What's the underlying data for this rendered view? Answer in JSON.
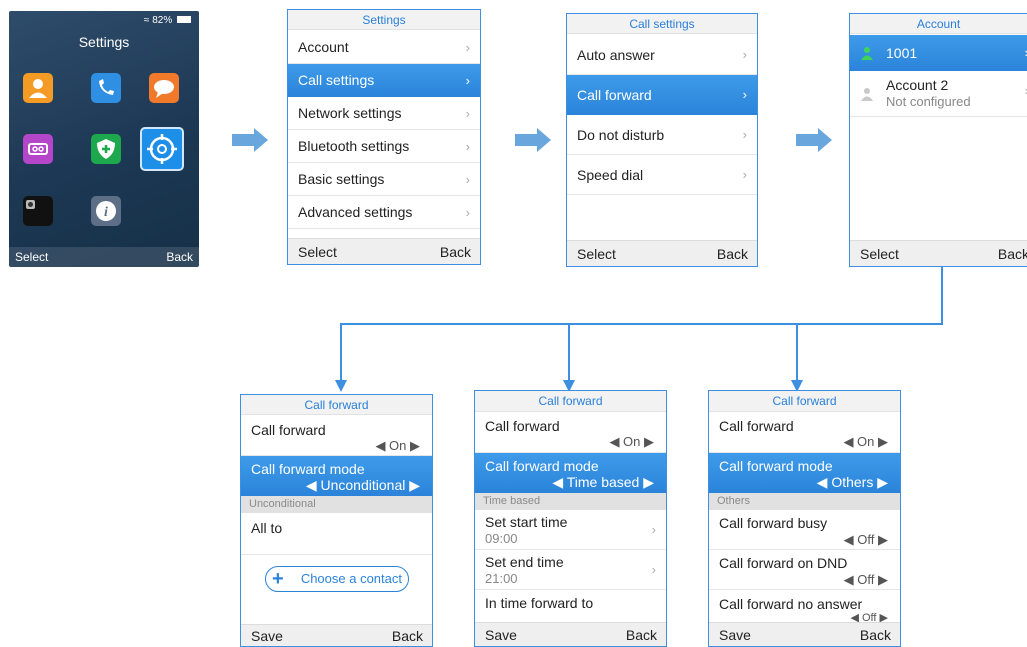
{
  "home": {
    "status": {
      "battery_pct": "82%"
    },
    "title": "Settings",
    "apps": [
      "contacts-icon",
      "call-history-icon",
      "messages-icon",
      "voicemail-icon",
      "security-icon",
      "settings-icon",
      "camera-icon",
      "info-icon"
    ],
    "softkeys": {
      "left": "Select",
      "right": "Back"
    }
  },
  "settings": {
    "title": "Settings",
    "items": [
      "Account",
      "Call settings",
      "Network settings",
      "Bluetooth settings",
      "Basic settings",
      "Advanced settings"
    ],
    "softkeys": {
      "left": "Select",
      "right": "Back"
    }
  },
  "call_settings": {
    "title": "Call settings",
    "items": [
      "Auto answer",
      "Call forward",
      "Do not disturb",
      "Speed dial"
    ],
    "softkeys": {
      "left": "Select",
      "right": "Back"
    }
  },
  "account": {
    "title": "Account",
    "items": [
      {
        "label": "1001"
      },
      {
        "label": "Account 2",
        "sub": "Not configured"
      }
    ],
    "softkeys": {
      "left": "Select",
      "right": "Back"
    }
  },
  "cf_unconditional": {
    "title": "Call forward",
    "call_forward_label": "Call forward",
    "call_forward_value": "On",
    "mode_label": "Call forward mode",
    "mode_value": "Unconditional",
    "section": "Unconditional",
    "all_to": "All to",
    "choose_contact": "Choose a contact",
    "softkeys": {
      "left": "Save",
      "right": "Back"
    }
  },
  "cf_time": {
    "title": "Call forward",
    "call_forward_label": "Call forward",
    "call_forward_value": "On",
    "mode_label": "Call forward mode",
    "mode_value": "Time based",
    "section": "Time based",
    "start_label": "Set start time",
    "start_value": "09:00",
    "end_label": "Set end time",
    "end_value": "21:00",
    "in_time_label": "In time forward to",
    "softkeys": {
      "left": "Save",
      "right": "Back"
    }
  },
  "cf_others": {
    "title": "Call forward",
    "call_forward_label": "Call forward",
    "call_forward_value": "On",
    "mode_label": "Call forward mode",
    "mode_value": "Others",
    "section": "Others",
    "busy_label": "Call forward busy",
    "busy_value": "Off",
    "dnd_label": "Call forward on DND",
    "dnd_value": "Off",
    "noans_label": "Call forward no answer",
    "noans_value": "Off",
    "softkeys": {
      "left": "Save",
      "right": "Back"
    }
  },
  "colors": {
    "accent": "#2b84da",
    "frame": "#3d8fe0",
    "arrow": "#6aa6de"
  }
}
